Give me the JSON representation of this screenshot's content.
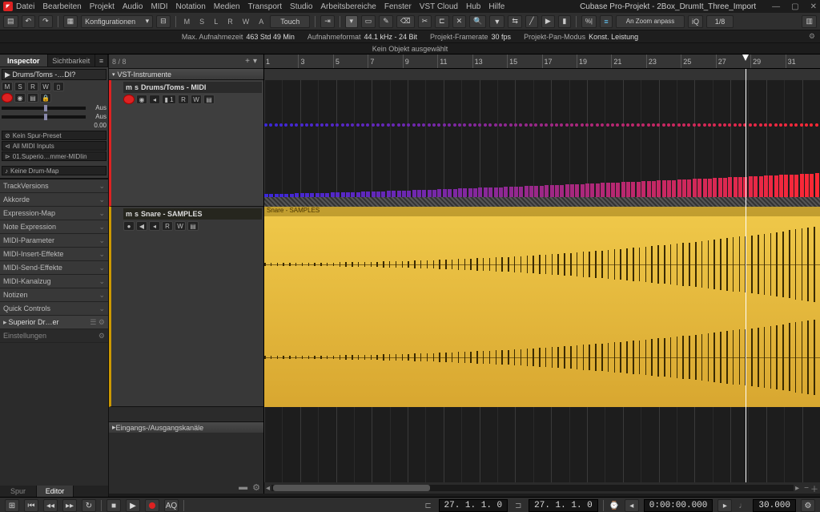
{
  "app": {
    "title": "Cubase Pro-Projekt - 2Box_DrumIt_Three_Import",
    "menu": [
      "Datei",
      "Bearbeiten",
      "Projekt",
      "Audio",
      "MIDI",
      "Notation",
      "Medien",
      "Transport",
      "Studio",
      "Arbeitsbereiche",
      "Fenster",
      "VST Cloud",
      "Hub",
      "Hilfe"
    ]
  },
  "toolbar": {
    "config_label": "Konfigurationen",
    "letters": [
      "M",
      "S",
      "L",
      "R",
      "W",
      "A"
    ],
    "automation_mode": "Touch",
    "snap_label": "An Zoom anpass",
    "iq_label": "iQ",
    "grid_label": "1/8"
  },
  "info": {
    "rec_time_label": "Max. Aufnahmezeit",
    "rec_time_val": "463 Std 49 Min",
    "format_label": "Aufnahmeformat",
    "format_val": "44.1 kHz - 24 Bit",
    "framerate_label": "Projekt-Framerate",
    "framerate_val": "30 fps",
    "pan_label": "Projekt-Pan-Modus",
    "pan_val": "Konst. Leistung"
  },
  "selection_line": "Kein Objekt ausgewählt",
  "inspector": {
    "tabs": [
      "Inspector",
      "Sichtbarkeit"
    ],
    "track_name": "Drums/Toms -…DI?",
    "buttons1": [
      "M",
      "S",
      "R",
      "W",
      "▯"
    ],
    "vol_label": "Aus",
    "pan_label": "Aus",
    "pan_val": "0.00",
    "preset": "Kein Spur-Preset",
    "input": "All MIDI Inputs",
    "output": "01.Superio…mmer-MIDIin",
    "drummap": "Keine Drum-Map",
    "sections": [
      "TrackVersions",
      "Akkorde",
      "Expression-Map",
      "Note Expression",
      "MIDI-Parameter",
      "MIDI-Insert-Effekte",
      "MIDI-Send-Effekte",
      "MIDI-Kanalzug",
      "Notizen",
      "Quick Controls"
    ],
    "instrument": "Superior Dr…er",
    "settings": "Einstellungen",
    "footer_tabs": [
      "Spur",
      "Editor"
    ]
  },
  "tracklist": {
    "counter": "8 / 8",
    "folder1": "VST-Instrumente",
    "track1_name": "Drums/Toms - MIDI",
    "track2_name": "Snare - SAMPLES",
    "io_folder": "Eingangs-/Ausgangskanäle"
  },
  "ruler": {
    "bars": [
      1,
      3,
      5,
      7,
      9,
      11,
      13,
      15,
      17,
      19,
      21,
      23,
      25,
      27,
      29,
      31
    ],
    "cursor_bar": 27
  },
  "clips": {
    "audio_title": "Snare - SAMPLES"
  },
  "transport": {
    "pos1": "27.  1.  1.    0",
    "pos2": "27.  1.  1.    0",
    "time": "0:00:00.000",
    "bars": "30.000"
  }
}
